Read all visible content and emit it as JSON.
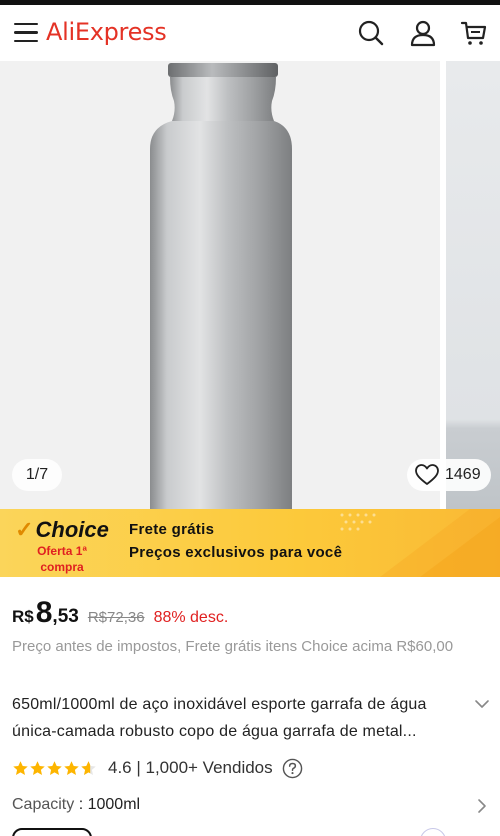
{
  "header": {
    "logo_text": "AliExpress",
    "brand_color": "#e43225",
    "icons": [
      "menu-icon",
      "search-icon",
      "user-icon",
      "cart-icon"
    ]
  },
  "gallery": {
    "page_indicator": "1/7",
    "favorites_count": "1469",
    "favorite_icon": "heart-icon"
  },
  "choice": {
    "logo_text": "Choice",
    "sub_line1": "Oferta 1ª",
    "sub_line2": "compra",
    "line1": "Frete grátis",
    "line2": "Preços exclusivos para você"
  },
  "price": {
    "currency": "R$",
    "integer": "8",
    "decimal": ",53",
    "old_price": "R$72,36",
    "discount": "88% desc.",
    "note": "Preço antes de impostos, Frete grátis itens Choice acima R$60,00"
  },
  "product": {
    "title": "650ml/1000ml de aço inoxidável esporte garrafa de água única-camada robusto copo de água garrafa de metal...",
    "rating": 4.6,
    "rating_text": "4.6 | 1,000+ Vendidos"
  },
  "capacity": {
    "label": "Capacity",
    "separator": " : ",
    "value": "1000ml"
  }
}
